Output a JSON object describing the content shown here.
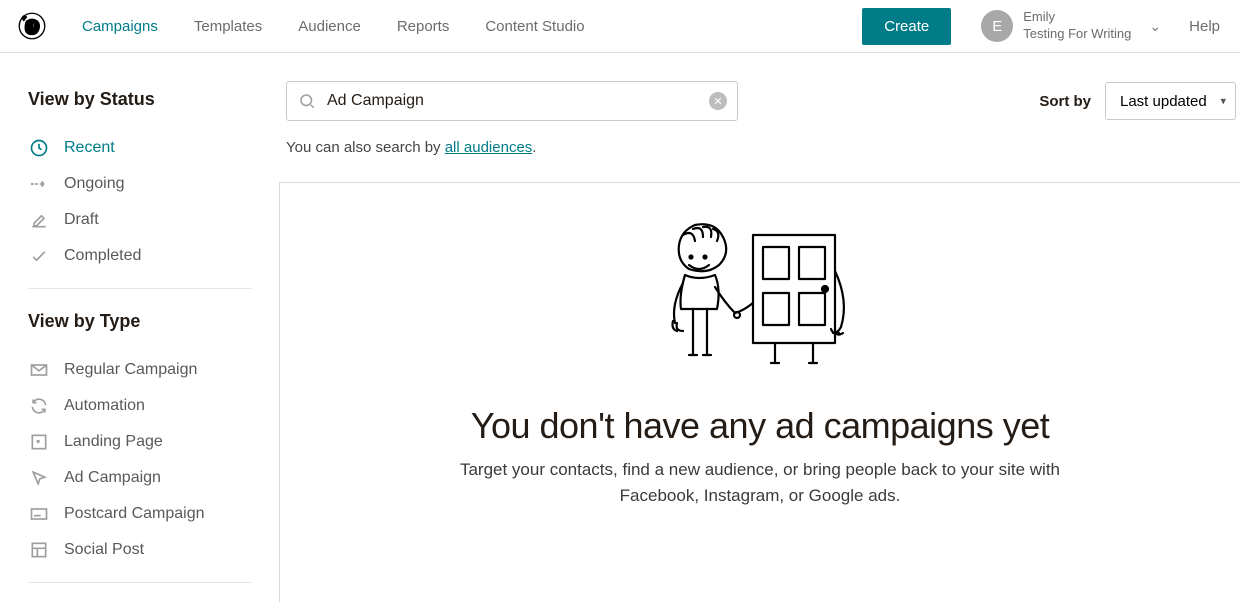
{
  "nav": {
    "items": [
      "Campaigns",
      "Templates",
      "Audience",
      "Reports",
      "Content Studio"
    ],
    "active_index": 0,
    "create_label": "Create",
    "help_label": "Help"
  },
  "account": {
    "initial": "E",
    "name": "Emily",
    "subtitle": "Testing For Writing"
  },
  "sidebar": {
    "status_heading": "View by Status",
    "status_items": [
      {
        "label": "Recent",
        "icon": "clock-icon",
        "active": true
      },
      {
        "label": "Ongoing",
        "icon": "arrow-dotted-icon",
        "active": false
      },
      {
        "label": "Draft",
        "icon": "pencil-icon",
        "active": false
      },
      {
        "label": "Completed",
        "icon": "check-icon",
        "active": false
      }
    ],
    "type_heading": "View by Type",
    "type_items": [
      {
        "label": "Regular Campaign",
        "icon": "envelope-icon"
      },
      {
        "label": "Automation",
        "icon": "refresh-icon"
      },
      {
        "label": "Landing Page",
        "icon": "heart-page-icon"
      },
      {
        "label": "Ad Campaign",
        "icon": "cursor-icon"
      },
      {
        "label": "Postcard Campaign",
        "icon": "postcard-icon"
      },
      {
        "label": "Social Post",
        "icon": "layout-icon"
      }
    ]
  },
  "search": {
    "value": "Ad Campaign",
    "hint_prefix": "You can also search by ",
    "hint_link": "all audiences",
    "hint_suffix": "."
  },
  "sort": {
    "label": "Sort by",
    "selected": "Last updated"
  },
  "empty": {
    "title": "You don't have any ad campaigns yet",
    "subtitle": "Target your contacts, find a new audience, or bring people back to your site with Facebook, Instagram, or Google ads."
  }
}
